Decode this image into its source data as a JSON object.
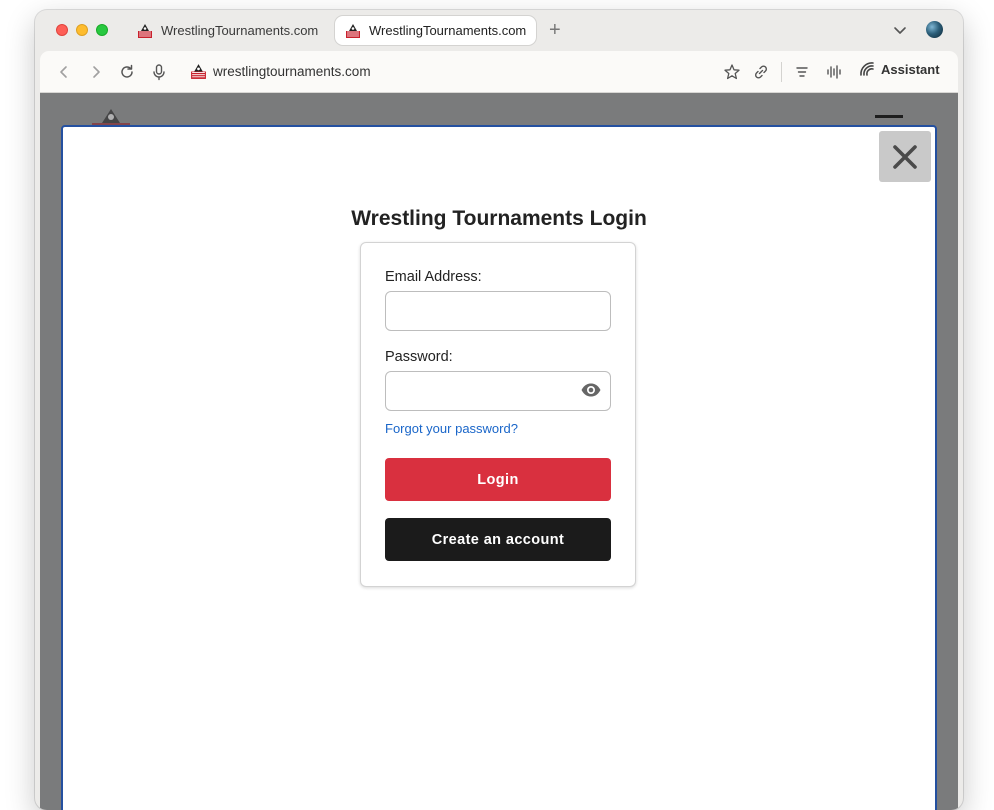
{
  "browser": {
    "tabs": [
      {
        "title": "WrestlingTournaments.com",
        "active": false
      },
      {
        "title": "WrestlingTournaments.com",
        "active": true
      }
    ],
    "new_tab_symbol": "+",
    "url": "wrestlingtournaments.com",
    "assistant_label": "Assistant",
    "icons": [
      "back-icon",
      "forward-icon",
      "reload-icon",
      "microphone-icon",
      "bookmark-star-icon",
      "link-icon",
      "reader-icon",
      "audio-icon",
      "assistant-icon",
      "tab-dropdown-icon",
      "close-icon",
      "eye-icon"
    ]
  },
  "login": {
    "title": "Wrestling Tournaments Login",
    "email_label": "Email Address:",
    "email_value": "",
    "password_label": "Password:",
    "password_value": "",
    "forgot_link": "Forgot your password?",
    "login_button": "Login",
    "create_button": "Create an account"
  },
  "colors": {
    "login_button": "#d9303f",
    "create_button": "#1b1b1b",
    "link": "#1a66c9",
    "modal_border": "#2450a0",
    "overlay": "#7a7b7c"
  }
}
